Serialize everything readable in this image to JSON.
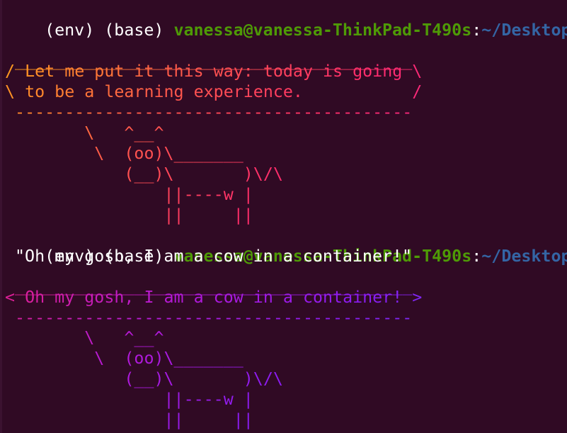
{
  "terminal": {
    "prompt1": {
      "env": "(env) (base) ",
      "user_host": "vanessa@vanessa-ThinkPad-T490s",
      "colon": ":",
      "cwd": "~/Desktop/Cod"
    },
    "cow1": {
      "top_border": " ________________________________________",
      "bubble_line1": "/ Let me put it this way: today is going \\",
      "bubble_line2": "\\ to be a learning experience.           /",
      "bottom_border": " ----------------------------------------",
      "cow_line1": "        \\   ^__^",
      "cow_line2": "         \\  (oo)\\_______",
      "cow_line3": "            (__)\\       )\\/\\",
      "cow_line4": "                ||----w |",
      "cow_line5": "                ||     ||"
    },
    "prompt2": {
      "env": "(env) (base) ",
      "user_host": "vanessa@vanessa-ThinkPad-T490s",
      "colon": ":",
      "cwd": "~/Desktop/Cod"
    },
    "command_output": " \"Oh my gosh, I am a cow in a container!\"",
    "cow2": {
      "top_border": " ________________________________________",
      "bubble_line1": "< Oh my gosh, I am a cow in a container! >",
      "bottom_border": " ----------------------------------------",
      "cow_line1": "        \\   ^__^",
      "cow_line2": "         \\  (oo)\\_______",
      "cow_line3": "            (__)\\       )\\/\\",
      "cow_line4": "                ||----w |",
      "cow_line5": "                ||     ||"
    }
  },
  "colors": {
    "background": "#300a24",
    "user_host": "#4e9a06",
    "cwd": "#3465a4",
    "cow1_gradient": [
      "#ff9f1c",
      "#ff5a4a",
      "#ff2d6b",
      "#f0228f"
    ],
    "cow2_gradient": [
      "#e0208f",
      "#b41ad8",
      "#8a1cf0",
      "#6a3ef5"
    ]
  }
}
